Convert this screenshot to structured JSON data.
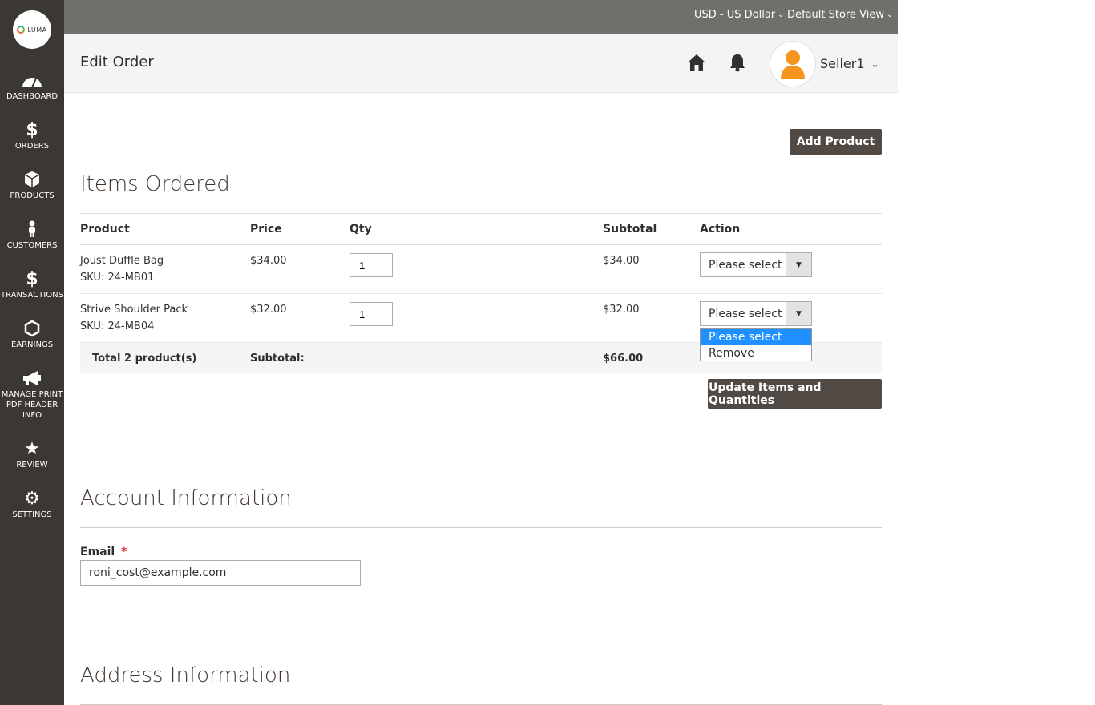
{
  "topbar": {
    "currency": "USD - US Dollar",
    "store_view": "Default Store View"
  },
  "logo": {
    "text": "LUMA"
  },
  "sidebar": {
    "items": [
      {
        "label": "DASHBOARD"
      },
      {
        "label": "ORDERS"
      },
      {
        "label": "PRODUCTS"
      },
      {
        "label": "CUSTOMERS"
      },
      {
        "label": "TRANSACTIONS"
      },
      {
        "label": "EARNINGS"
      },
      {
        "label": "MANAGE PRINT PDF HEADER INFO"
      },
      {
        "label": "REVIEW"
      },
      {
        "label": "SETTINGS"
      }
    ]
  },
  "header": {
    "title": "Edit Order",
    "user": "Seller1"
  },
  "buttons": {
    "add_product": "Add Product",
    "update_items": "Update Items and Quantities"
  },
  "items_section": {
    "title": "Items Ordered",
    "columns": [
      "Product",
      "Price",
      "Qty",
      "Subtotal",
      "Action"
    ],
    "rows": [
      {
        "name": "Joust Duffle Bag",
        "sku": "SKU: 24-MB01",
        "price": "$34.00",
        "qty": "1",
        "subtotal": "$34.00",
        "action": "Please select"
      },
      {
        "name": "Strive Shoulder Pack",
        "sku": "SKU: 24-MB04",
        "price": "$32.00",
        "qty": "1",
        "subtotal": "$32.00",
        "action": "Please select"
      }
    ],
    "total_label": "Total 2 product(s)",
    "subtotal_label": "Subtotal:",
    "subtotal_value": "$66.00",
    "dropdown_options": [
      "Please select",
      "Remove"
    ]
  },
  "account_section": {
    "title": "Account Information",
    "email_label": "Email",
    "required_mark": "*",
    "email_value": "roni_cost@example.com"
  },
  "address_section": {
    "title": "Address Information"
  },
  "colors": {
    "sidebar_bg": "#3b3733",
    "topbar_bg": "#6f6f6b",
    "button_bg": "#514943",
    "avatar_orange": "#f7941d",
    "dropdown_highlight": "#1e90ff"
  }
}
